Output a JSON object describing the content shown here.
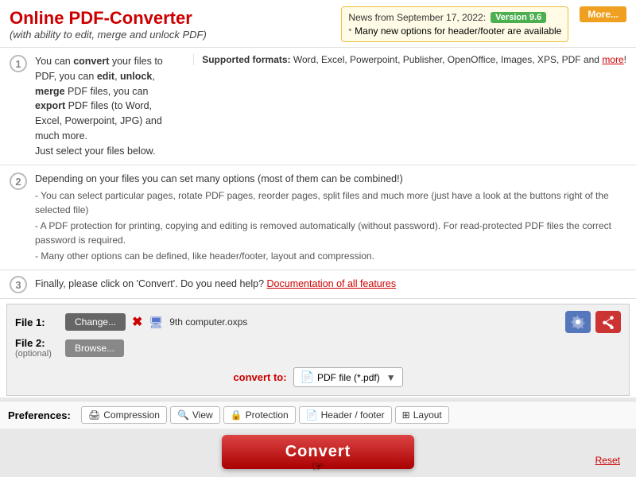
{
  "header": {
    "title": "Online PDF-Converter",
    "subtitle": "(with ability to edit, merge and unlock PDF)",
    "news_label": "News from September 17, 2022:",
    "news_version": "Version 9.6",
    "news_bullet": "Many new options for header/footer are available",
    "more_button": "More..."
  },
  "steps": {
    "step1": {
      "num": "1",
      "text_plain": "You can ",
      "text_bold1": "convert",
      "text_mid": " your files to PDF, you can ",
      "text_bold2": "edit",
      "text_comma": ", ",
      "text_bold3": "unlock",
      "text_comma2": ", ",
      "text_bold4": "merge",
      "text_after": " PDF files, you can ",
      "text_bold5": "export",
      "text_end": " PDF files (to Word, Excel, Powerpoint, JPG) and much more.",
      "text_line2": "Just select your files below.",
      "aside_label": "Supported formats:",
      "aside_formats": "Word, Excel, Powerpoint, Publisher, OpenOffice, Images, XPS, PDF and ",
      "aside_more": "more",
      "aside_exclaim": "!"
    },
    "step2": {
      "num": "2",
      "line1": "Depending on your files you can set many options (most of them can be combined!)",
      "bullet1": "- You can select particular pages, rotate PDF pages, reorder pages, split files and much more (just have a look at the buttons right of the selected file)",
      "bullet2": "- A PDF protection for printing, copying and editing is removed automatically (without password). For read-protected PDF files the correct password is required.",
      "bullet3": "- Many other options can be defined, like header/footer, layout and compression."
    },
    "step3": {
      "num": "3",
      "text_before": "Finally, please click on 'Convert'. Do you need help? ",
      "link_text": "Documentation of all features"
    }
  },
  "file_area": {
    "file1_label": "File 1:",
    "file2_label": "File 2:",
    "optional_label": "(optional)",
    "change_btn": "Change...",
    "browse_btn": "Browse...",
    "filename": "9th computer.oxps",
    "convert_to_label": "convert to:",
    "format_label": "PDF file (*.pdf)"
  },
  "preferences": {
    "label": "Preferences:",
    "tabs": [
      {
        "id": "compression",
        "icon": "🖨",
        "label": "Compression"
      },
      {
        "id": "view",
        "icon": "🔍",
        "label": "View"
      },
      {
        "id": "protection",
        "icon": "🔒",
        "label": "Protection"
      },
      {
        "id": "header-footer",
        "icon": "📄",
        "label": "Header / footer"
      },
      {
        "id": "layout",
        "icon": "⊞",
        "label": "Layout"
      }
    ]
  },
  "convert_button": "Convert",
  "reset_link": "Reset"
}
